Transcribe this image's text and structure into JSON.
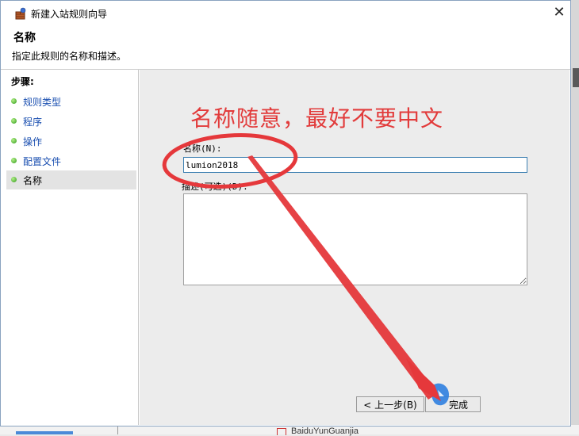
{
  "window": {
    "title": "新建入站规则向导",
    "close_glyph": "✕",
    "app_icon": "firewall-wizard-icon"
  },
  "header": {
    "title": "名称",
    "subtitle": "指定此规则的名称和描述。"
  },
  "steps": {
    "title": "步骤:",
    "items": [
      {
        "label": "规则类型",
        "active": false
      },
      {
        "label": "程序",
        "active": false
      },
      {
        "label": "操作",
        "active": false
      },
      {
        "label": "配置文件",
        "active": false
      },
      {
        "label": "名称",
        "active": true
      }
    ]
  },
  "form": {
    "name_label": "名称(N):",
    "name_value": "lumion2018",
    "description_label": "描述(可选)(D):",
    "description_value": ""
  },
  "annotation": {
    "text": "名称随意，最好不要中文",
    "color": "#e23b3b"
  },
  "buttons": {
    "back": "< 上一步(B)",
    "finish": "完成"
  },
  "taskbar": {
    "item_label": "BaiduYunGuanjia"
  }
}
